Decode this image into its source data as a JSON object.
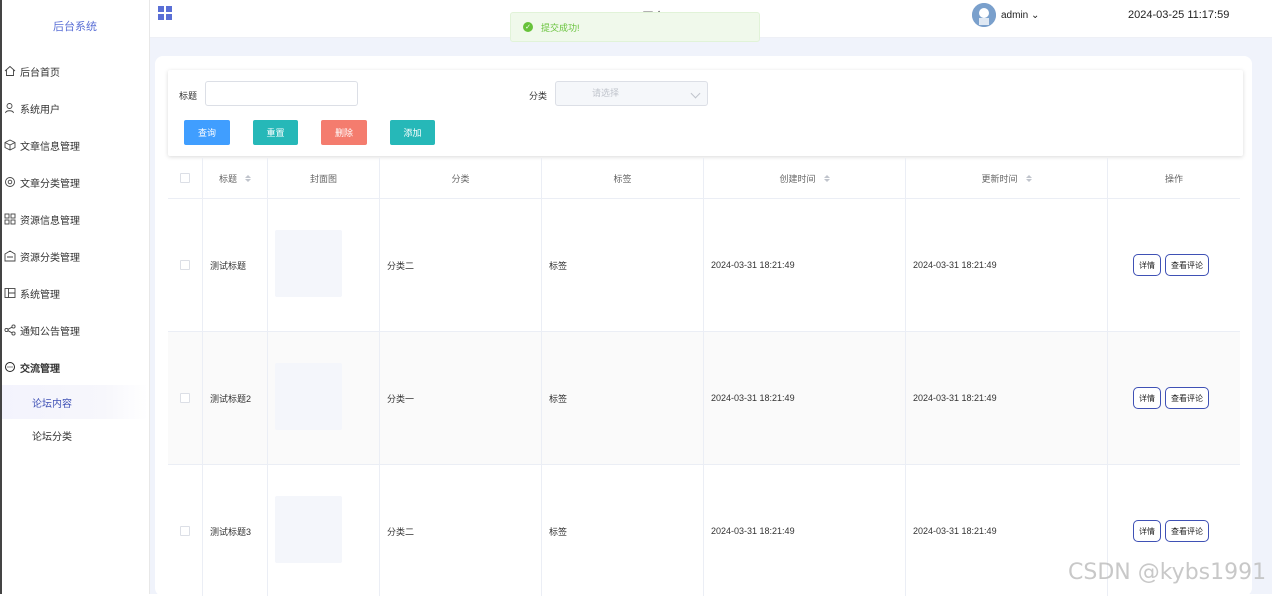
{
  "sidebar": {
    "brand": "后台系统",
    "items": [
      {
        "label": "后台首页",
        "icon": "home-icon"
      },
      {
        "label": "系统用户",
        "icon": "user-icon"
      },
      {
        "label": "文章信息管理",
        "icon": "cube-icon"
      },
      {
        "label": "文章分类管理",
        "icon": "gear-icon"
      },
      {
        "label": "资源信息管理",
        "icon": "grid-icon"
      },
      {
        "label": "资源分类管理",
        "icon": "box-icon"
      },
      {
        "label": "系统管理",
        "icon": "layout-icon"
      },
      {
        "label": "通知公告管理",
        "icon": "share-icon"
      },
      {
        "label": "交流管理",
        "icon": "chat-icon"
      }
    ],
    "sub_items": [
      {
        "label": "论坛内容",
        "active": true
      },
      {
        "label": "论坛分类",
        "active": false
      }
    ]
  },
  "header": {
    "title": "…平台",
    "user": "admin",
    "datetime": "2024-03-25 11:17:59"
  },
  "toast": {
    "message": "提交成功!",
    "color": "#67c23a"
  },
  "search": {
    "title_label": "标题",
    "title_value": "",
    "category_label": "分类",
    "category_placeholder": "请选择",
    "buttons": [
      {
        "label": "查询",
        "color": "#409eff"
      },
      {
        "label": "重置",
        "color": "#26b8b8"
      },
      {
        "label": "删除",
        "color": "#f47c6e"
      },
      {
        "label": "添加",
        "color": "#26b8b8"
      }
    ]
  },
  "table": {
    "columns": [
      "标题",
      "封面图",
      "分类",
      "标签",
      "创建时间",
      "更新时间",
      "操作"
    ],
    "rows": [
      {
        "title": "测试标题",
        "category": "分类二",
        "tag": "标签",
        "created": "2024-03-31 18:21:49",
        "updated": "2024-03-31 18:21:49"
      },
      {
        "title": "测试标题2",
        "category": "分类一",
        "tag": "标签",
        "created": "2024-03-31 18:21:49",
        "updated": "2024-03-31 18:21:49"
      },
      {
        "title": "测试标题3",
        "category": "分类二",
        "tag": "标签",
        "created": "2024-03-31 18:21:49",
        "updated": "2024-03-31 18:21:49"
      }
    ],
    "actions": [
      "详情",
      "查看评论"
    ]
  },
  "watermark": "CSDN @kybs1991"
}
